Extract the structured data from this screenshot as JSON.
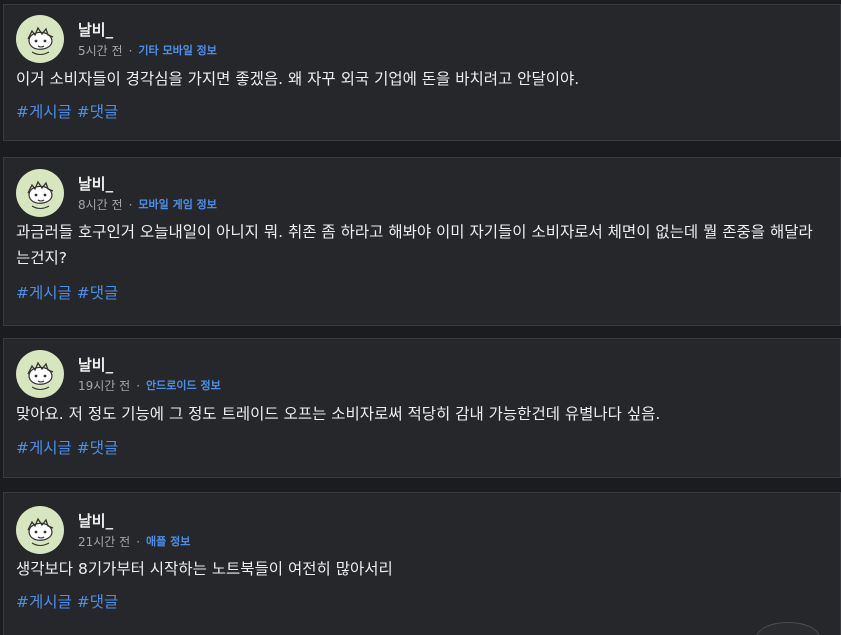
{
  "posts": [
    {
      "author": "날비_",
      "time": "5시간 전",
      "separator": "·",
      "category": "기타 모바일 정보",
      "body": "이거 소비자들이 경각심을 가지면 좋겠음. 왜 자꾸 외국 기업에 돈을 바치려고 안달이야.",
      "tags": [
        "#게시글",
        "#댓글"
      ]
    },
    {
      "author": "날비_",
      "time": "8시간 전",
      "separator": "·",
      "category": "모바일 게임 정보",
      "body": "과금러들 호구인거 오늘내일이 아니지 뭐. 취존 좀 하라고 해봐야 이미 자기들이 소비자로서 체면이 없는데 뭘 존중을 해달라는건지?",
      "tags": [
        "#게시글",
        "#댓글"
      ]
    },
    {
      "author": "날비_",
      "time": "19시간 전",
      "separator": "·",
      "category": "안드로이드 정보",
      "body": "맞아요. 저 정도 기능에 그 정도 트레이드 오프는 소비자로써 적당히 감내 가능한건데 유별나다 싶음.",
      "tags": [
        "#게시글",
        "#댓글"
      ]
    },
    {
      "author": "날비_",
      "time": "21시간 전",
      "separator": "·",
      "category": "애플 정보",
      "body": "생각보다 8기가부터 시작하는 노트북들이 여전히 많아서리",
      "tags": [
        "#게시글",
        "#댓글"
      ]
    }
  ],
  "colors": {
    "background": "#1b1c1f",
    "card": "#26272b",
    "accent": "#4d8fe8",
    "avatar_bg": "#d8e6bf"
  },
  "icons": {
    "avatar": "cartoon-face-avatar"
  }
}
